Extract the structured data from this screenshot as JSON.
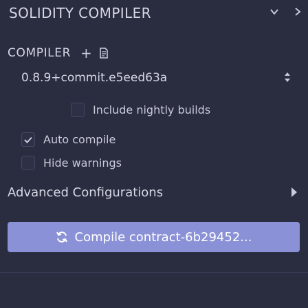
{
  "header": {
    "title": "SOLIDITY COMPILER",
    "chevron_down_icon": "chevron-down-icon",
    "chevron_right_icon": "chevron-right-icon"
  },
  "compiler": {
    "label": "COMPILER",
    "add_label": "+",
    "file_icon": "file-icon",
    "selected_version": "0.8.9+commit.e5eed63a",
    "sort_icon": "sort-icon"
  },
  "options": {
    "include_nightly": {
      "label": "Include nightly builds",
      "checked": false
    },
    "auto_compile": {
      "label": "Auto compile",
      "checked": true
    },
    "hide_warnings": {
      "label": "Hide warnings",
      "checked": false
    }
  },
  "advanced": {
    "label": "Advanced Configurations",
    "chevron_icon": "chevron-right-icon"
  },
  "compile_button": {
    "label": "Compile contract-6b29452...",
    "icon": "sync-icon"
  },
  "colors": {
    "background": "#2a2c3f",
    "text": "#c9cbdb",
    "accent": "#8a91d6",
    "checkbox_border": "#444863"
  }
}
